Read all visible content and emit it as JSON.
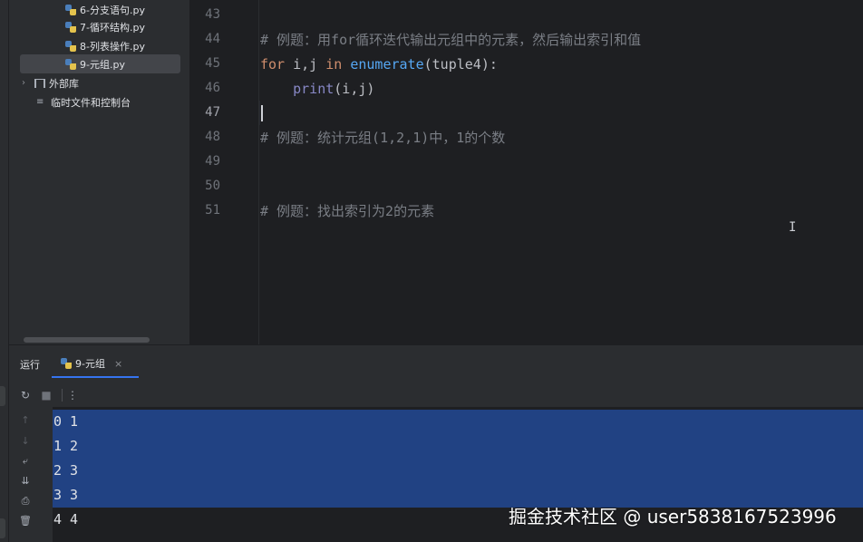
{
  "project_tree": {
    "items": [
      {
        "label": "6-分支语句.py",
        "type": "py"
      },
      {
        "label": "7-循环结构.py",
        "type": "py"
      },
      {
        "label": "8-列表操作.py",
        "type": "py"
      },
      {
        "label": "9-元组.py",
        "type": "py",
        "selected": true
      }
    ],
    "external_libs": "外部库",
    "scratches": "临时文件和控制台"
  },
  "editor": {
    "line_numbers": [
      "43",
      "44",
      "45",
      "46",
      "47",
      "48",
      "49",
      "50",
      "51"
    ],
    "current_line": "47",
    "lines": {
      "l44": "# 例题：用for循环迭代输出元组中的元素，然后输出索引和值",
      "l45_kw1": "for",
      "l45_vars": " i,j ",
      "l45_kw2": "in",
      "l45_sp": " ",
      "l45_fn": "enumerate",
      "l45_rest": "(tuple4):",
      "l46_indent": "    ",
      "l46_fn": "print",
      "l46_rest": "(i,j)",
      "l48": "# 例题：统计元组(1,2,1)中，1的个数",
      "l51": "# 例题：找出索引为2的元素"
    }
  },
  "run_panel": {
    "title": "运行",
    "tab_label": "9-元组",
    "tab_close": "×",
    "output": [
      "0 1",
      "1 2",
      "2 3",
      "3 3",
      "4 4"
    ]
  },
  "watermark": "掘金技术社区 @ user5838167523996",
  "colors": {
    "keyword": "#cf8e6d",
    "function": "#56a8f5",
    "builtin": "#8888c6",
    "comment": "#7a7e85",
    "selection": "#214283"
  }
}
